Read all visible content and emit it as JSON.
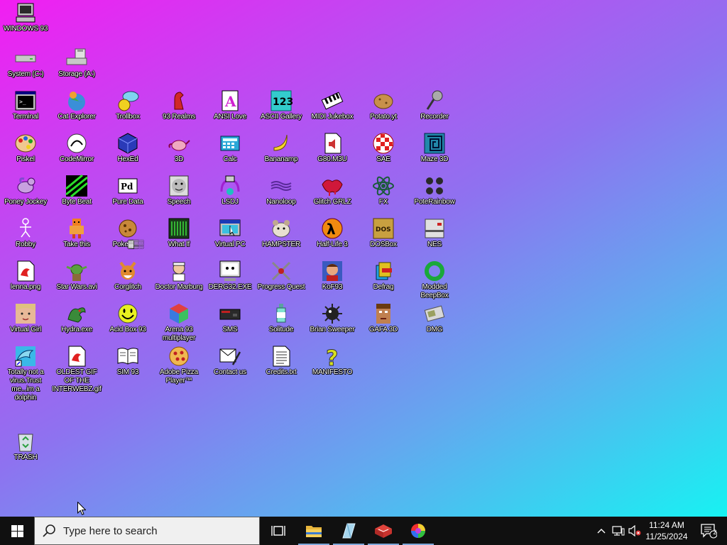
{
  "desktop": {
    "icons": [
      {
        "label": "WINDOWS 93",
        "icon": "computer-icon"
      },
      {
        "label": "System (C:)",
        "icon": "drive-icon"
      },
      {
        "label": "Storage (A:)",
        "icon": "floppy-drive-icon"
      },
      {
        "label": "Terminal",
        "icon": "terminal-icon"
      },
      {
        "label": "Cat Explorer",
        "icon": "cat-globe-icon"
      },
      {
        "label": "Trollbox",
        "icon": "chat-icon"
      },
      {
        "label": "93 Realms",
        "icon": "knight-icon"
      },
      {
        "label": "ANSI Love",
        "icon": "ansi-letter-icon"
      },
      {
        "label": "ASCII Gallery",
        "icon": "numbers-icon"
      },
      {
        "label": "MIDI Jukebox",
        "icon": "piano-icon"
      },
      {
        "label": "Potato.yt",
        "icon": "potato-icon"
      },
      {
        "label": "Recorder",
        "icon": "microphone-icon"
      },
      {
        "label": "Piskel",
        "icon": "palette-icon"
      },
      {
        "label": "CodeMirror",
        "icon": "codemirror-icon"
      },
      {
        "label": "HexEd",
        "icon": "cube-icon"
      },
      {
        "label": "3D",
        "icon": "teapot-icon"
      },
      {
        "label": "Calc",
        "icon": "calculator-icon"
      },
      {
        "label": "Bananamp",
        "icon": "banana-icon"
      },
      {
        "label": "G80.M3U",
        "icon": "audio-file-icon"
      },
      {
        "label": "SAE",
        "icon": "amiga-ball-icon"
      },
      {
        "label": "Maze 3D",
        "icon": "maze-icon"
      },
      {
        "label": "Poney Jockey",
        "icon": "pony-icon"
      },
      {
        "label": "Byte Beat",
        "icon": "bytebeat-icon"
      },
      {
        "label": "Pure Data",
        "icon": "puredata-icon"
      },
      {
        "label": "Speech",
        "icon": "face-icon"
      },
      {
        "label": "LSDJ",
        "icon": "lsdj-icon"
      },
      {
        "label": "Nanoloop",
        "icon": "waves-icon"
      },
      {
        "label": "Glitch GRLZ",
        "icon": "lips-icon"
      },
      {
        "label": "FX",
        "icon": "atom-icon"
      },
      {
        "label": "PoteRainbow",
        "icon": "people-icon"
      },
      {
        "label": "Robby",
        "icon": "stick-figure-icon"
      },
      {
        "label": "Take this",
        "icon": "pixel-character-icon"
      },
      {
        "label": "Poke▓▒░",
        "icon": "cookie-icon"
      },
      {
        "label": "What If",
        "icon": "green-terminal-icon"
      },
      {
        "label": "Virtual PC",
        "icon": "window-cursor-icon"
      },
      {
        "label": "HAMPSTER",
        "icon": "hamster-icon"
      },
      {
        "label": "Half-Life 3",
        "icon": "half-life-icon"
      },
      {
        "label": "DOSBox",
        "icon": "dosbox-icon"
      },
      {
        "label": "NES",
        "icon": "nes-icon"
      },
      {
        "label": "lenna.png",
        "icon": "image-file-icon"
      },
      {
        "label": "Star Wars.avi",
        "icon": "yoda-icon"
      },
      {
        "label": "Corglitch",
        "icon": "corgi-icon"
      },
      {
        "label": "Doctor Marburg",
        "icon": "doctor-icon"
      },
      {
        "label": "DERG32.EXE",
        "icon": "derg-monitor-icon"
      },
      {
        "label": "Progress Quest",
        "icon": "crossed-swords-icon"
      },
      {
        "label": "KoF93",
        "icon": "fighter-icon"
      },
      {
        "label": "Defrag",
        "icon": "defrag-icon"
      },
      {
        "label": "Modded BeepBox",
        "icon": "ring-icon"
      },
      {
        "label": "Virtual Girl",
        "icon": "girl-face-icon"
      },
      {
        "label": "Hydra.exe",
        "icon": "dragon-icon"
      },
      {
        "label": "Acid Box 93",
        "icon": "smiley-icon"
      },
      {
        "label": "Arena 93 multiplayer",
        "icon": "color-cube-icon"
      },
      {
        "label": "SMS",
        "icon": "console-icon"
      },
      {
        "label": "Solitude",
        "icon": "bottle-icon"
      },
      {
        "label": "Brian Sweeper",
        "icon": "mine-icon"
      },
      {
        "label": "GAFA 3D",
        "icon": "doomguy-icon"
      },
      {
        "label": "DMG",
        "icon": "gameboy-icon"
      },
      {
        "label": "Totally not a virus.Trust me...im a dolphin",
        "icon": "dolphin-icon"
      },
      {
        "label": "OLDEST GIF OF THE INTERWEBZ.gif",
        "icon": "gif-file-icon"
      },
      {
        "label": "SIM 93",
        "icon": "book-icon"
      },
      {
        "label": "Adobe Pizza Player™",
        "icon": "pizza-icon"
      },
      {
        "label": "Contact us",
        "icon": "contact-icon"
      },
      {
        "label": "Credits.txt",
        "icon": "text-file-icon"
      },
      {
        "label": "MANIFESTO",
        "icon": "question-mark-icon"
      },
      {
        "label": "TRASH",
        "icon": "recycle-bin-icon"
      }
    ]
  },
  "taskbar": {
    "search_placeholder": "Type here to search",
    "time": "11:24 AM",
    "date": "11/25/2024",
    "notification_count": "2"
  }
}
